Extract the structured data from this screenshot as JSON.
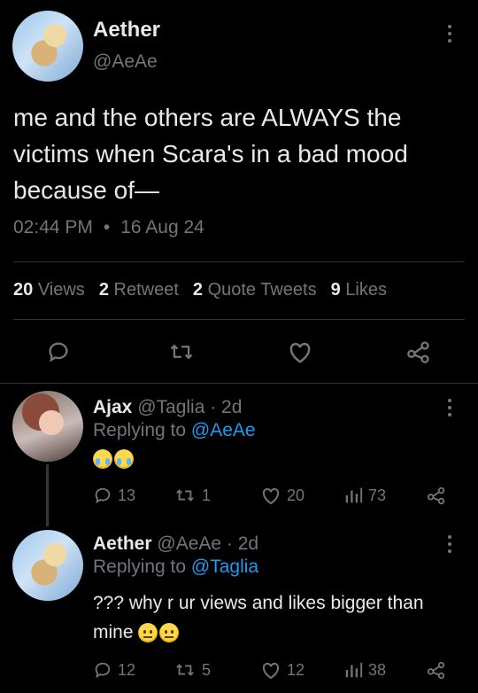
{
  "main_tweet": {
    "author_name": "Aether",
    "author_handle": "@AeAe",
    "text_lines": [
      "me and the others are ALWAYS the",
      "victims when Scara's in a bad mood",
      "because of—"
    ],
    "time": "02:44 PM",
    "dot": "•",
    "date": "16 Aug 24",
    "stats": {
      "views_count": "20",
      "views_label": "Views",
      "retweets_count": "2",
      "retweets_label": "Retweet",
      "quotes_count": "2",
      "quotes_label": "Quote Tweets",
      "likes_count": "9",
      "likes_label": "Likes"
    },
    "actions": [
      "reply-icon",
      "retweet-icon",
      "like-icon",
      "share-icon"
    ]
  },
  "replies": [
    {
      "author_name": "Ajax",
      "author_handle": "@Taglia",
      "time": "· 2d",
      "replying_prefix": "Replying to",
      "replying_to": "@AeAe",
      "text": "",
      "emojis": [
        "loudly-crying-face",
        "loudly-crying-face"
      ],
      "reply_count": "13",
      "retweet_count": "1",
      "like_count": "20",
      "view_count": "73"
    },
    {
      "author_name": "Aether",
      "author_handle": "@AeAe",
      "time": "· 2d",
      "replying_prefix": "Replying to",
      "replying_to": "@Taglia",
      "text_line1": "??? why r ur views and likes bigger than",
      "text_line2": "mine",
      "emojis": [
        "neutral-face",
        "neutral-face"
      ],
      "reply_count": "12",
      "retweet_count": "5",
      "like_count": "12",
      "view_count": "38"
    }
  ],
  "colors": {
    "background": "#000000",
    "text": "#e7e9ea",
    "muted": "#71767b",
    "link": "#1d9bf0",
    "divider": "#2f3336"
  }
}
